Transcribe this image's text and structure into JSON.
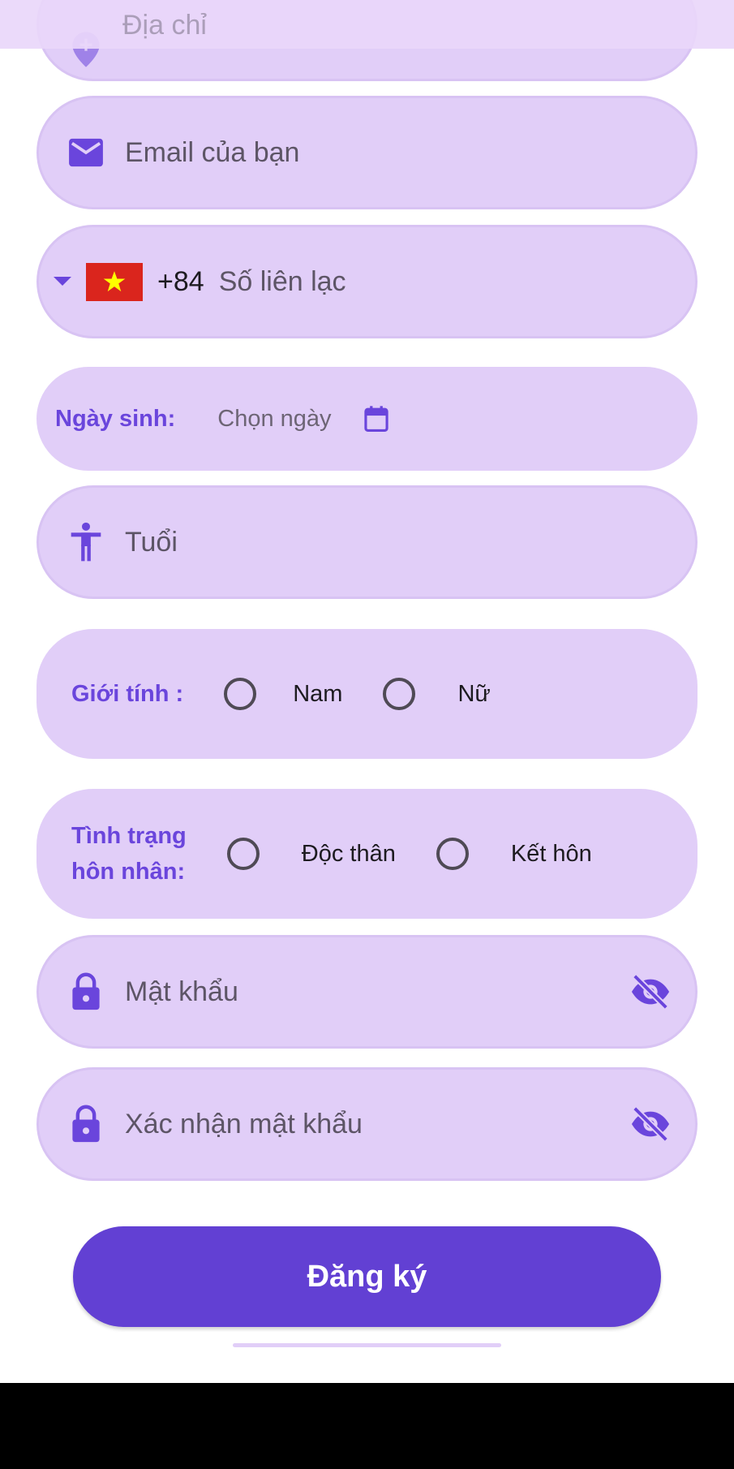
{
  "form": {
    "address_placeholder": "Địa chỉ",
    "email_placeholder": "Email của bạn",
    "phone": {
      "country_code": "+84",
      "placeholder": "Số liên lạc"
    },
    "birthday": {
      "label": "Ngày sinh:",
      "value": "Chọn ngày"
    },
    "age_placeholder": "Tuổi",
    "gender": {
      "label": "Giới tính :",
      "options": [
        "Nam",
        "Nữ"
      ]
    },
    "marital": {
      "label_line1": "Tình trạng",
      "label_line2": "hôn nhân:",
      "options": [
        "Độc thân",
        "Kết hôn"
      ]
    },
    "password_placeholder": "Mật khẩu",
    "confirm_password_placeholder": "Xác nhận mật khẩu",
    "submit_label": "Đăng ký"
  },
  "icons": {
    "address": "location-pin-icon",
    "email": "mail-icon",
    "dropdown": "caret-down-icon",
    "flag": "vietnam-flag-icon",
    "calendar": "calendar-icon",
    "age": "accessibility-person-icon",
    "lock": "lock-icon",
    "visibility": "visibility-off-icon"
  },
  "colors": {
    "field_bg": "#e1cef8",
    "accent": "#6a45dc",
    "button": "#6240d3",
    "flag_red": "#da251d",
    "flag_star": "#ffff00"
  }
}
